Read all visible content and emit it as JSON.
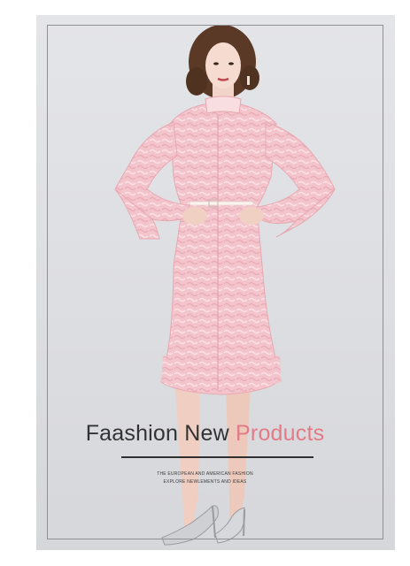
{
  "image": {
    "subject": "model-in-pink-lace-dress",
    "colors": {
      "dress": "#f2c2c9",
      "background": "#dfe0e3",
      "accent_text": "#e47a86",
      "dark_text": "#333333"
    }
  },
  "headline": {
    "part1": "Faashion New",
    "part2": "Products"
  },
  "tagline": {
    "line1": "THE EUROPEAN AND AMERICAN FASHION",
    "line2": "EXPLORE NEWLEMENTS AND IDEAS"
  }
}
